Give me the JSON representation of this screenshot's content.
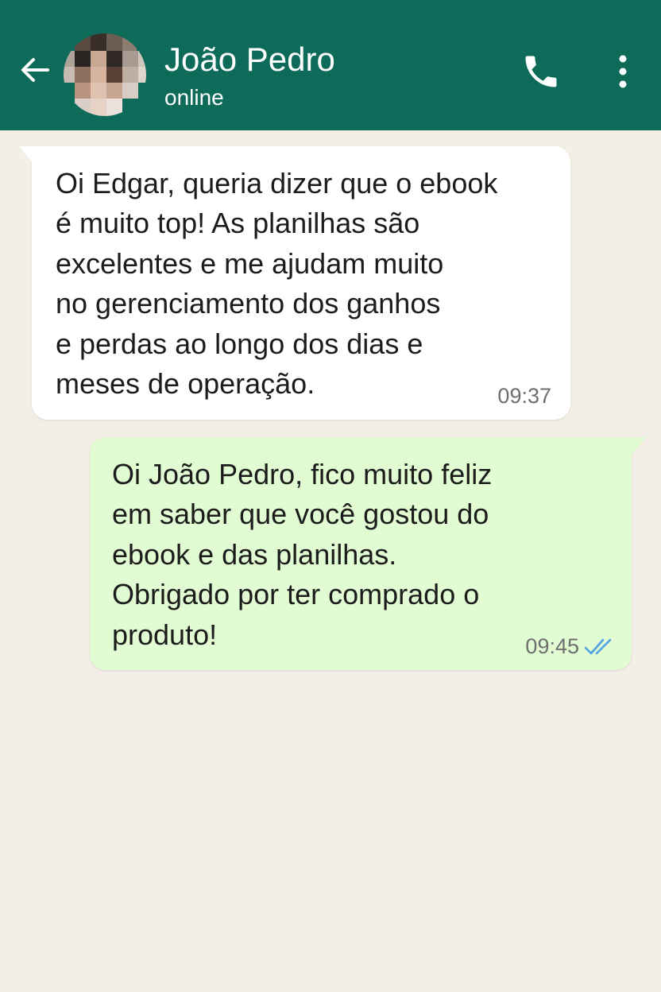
{
  "header": {
    "contact_name": "João Pedro",
    "contact_status": "online",
    "back_icon": "arrow-left-icon",
    "call_icon": "phone-icon",
    "menu_icon": "more-vertical-icon",
    "background_color": "#0e6b5a"
  },
  "chat": {
    "background_color": "#f3efe7",
    "messages": [
      {
        "direction": "incoming",
        "text": "Oi Edgar, queria dizer que o ebook\né muito top! As planilhas são\nexcelentes e me ajudam muito\nno gerenciamento dos ganhos\ne perdas ao longo dos dias e\nmeses de operação.",
        "time": "09:37",
        "bubble_color": "#ffffff"
      },
      {
        "direction": "outgoing",
        "text": "Oi João Pedro, fico muito feliz\nem saber que você gostou do\nebook e das planilhas.\nObrigado por ter comprado o\nproduto!",
        "time": "09:45",
        "status": "read",
        "status_icon": "double-check-icon",
        "bubble_color": "#e1fbd2",
        "tick_color": "#4fa3e0"
      }
    ]
  }
}
